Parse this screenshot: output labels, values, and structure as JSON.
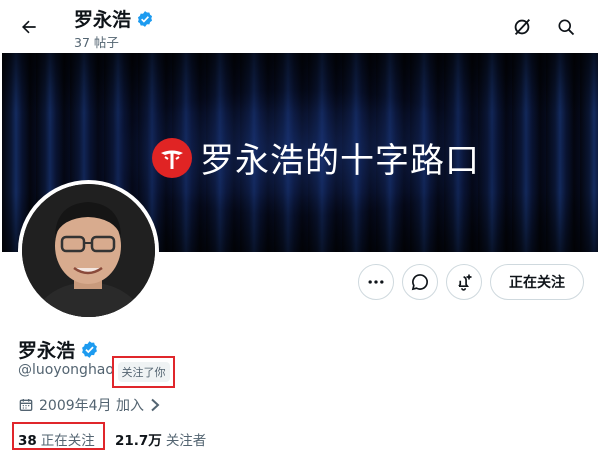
{
  "header": {
    "name": "罗永浩",
    "post_count": "37 帖子",
    "back_icon": "arrow-left-icon",
    "grok_icon": "grok-slash-circle-icon",
    "search_icon": "search-icon"
  },
  "banner": {
    "text": "罗永浩的十字路口",
    "logo_icon": "red-circle-tree-logo"
  },
  "actions": {
    "more_icon": "more-dots-icon",
    "message_icon": "message-bubble-icon",
    "notify_icon": "notification-bell-plus-icon",
    "following_label": "正在关注"
  },
  "profile": {
    "name": "罗永浩",
    "handle": "@luoyonghao",
    "follows_you": "关注了你",
    "joined": "2009年4月 加入",
    "following_count": "38",
    "following_label": "正在关注",
    "followers_count": "21.7万",
    "followers_label": "关注者"
  },
  "colors": {
    "verified": "#1d9bf0",
    "highlight_box": "#e0262b",
    "secondary_text": "#536471"
  }
}
